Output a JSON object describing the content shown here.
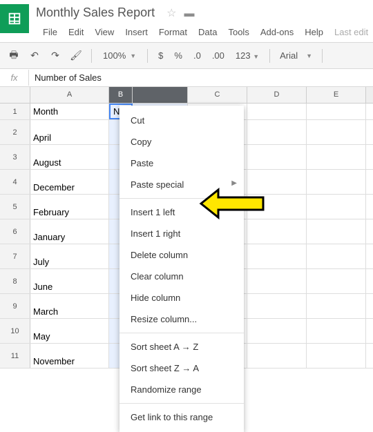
{
  "doc": {
    "title": "Monthly Sales Report",
    "last_edit": "Last edit"
  },
  "menus": {
    "file": "File",
    "edit": "Edit",
    "view": "View",
    "insert": "Insert",
    "format": "Format",
    "data": "Data",
    "tools": "Tools",
    "addons": "Add-ons",
    "help": "Help"
  },
  "toolbar": {
    "zoom": "100%",
    "dollar": "$",
    "percent": "%",
    "dec0": ".0",
    "dec00": ".00",
    "onestwothree": "123",
    "font": "Arial"
  },
  "fx": {
    "label": "fx",
    "value": "Number of Sales"
  },
  "cols": {
    "A": "A",
    "B": "B",
    "C": "C",
    "D": "D",
    "E": "E"
  },
  "rows": {
    "r1": {
      "A": "Month",
      "B": "Num"
    },
    "r2": {
      "A": "April"
    },
    "r3": {
      "A": "August"
    },
    "r4": {
      "A": "December"
    },
    "r5": {
      "A": "February"
    },
    "r6": {
      "A": "January"
    },
    "r7": {
      "A": "July"
    },
    "r8": {
      "A": "June"
    },
    "r9": {
      "A": "March"
    },
    "r10": {
      "A": "May"
    },
    "r11": {
      "A": "November"
    }
  },
  "ctx": {
    "cut": "Cut",
    "copy": "Copy",
    "paste": "Paste",
    "paste_special": "Paste special",
    "insert_left": "Insert 1 left",
    "insert_right": "Insert 1 right",
    "delete_col": "Delete column",
    "clear_col": "Clear column",
    "hide_col": "Hide column",
    "resize_col": "Resize column...",
    "sort_az": "Sort sheet A → Z",
    "sort_za": "Sort sheet Z → A",
    "randomize": "Randomize range",
    "get_link": "Get link to this range"
  }
}
